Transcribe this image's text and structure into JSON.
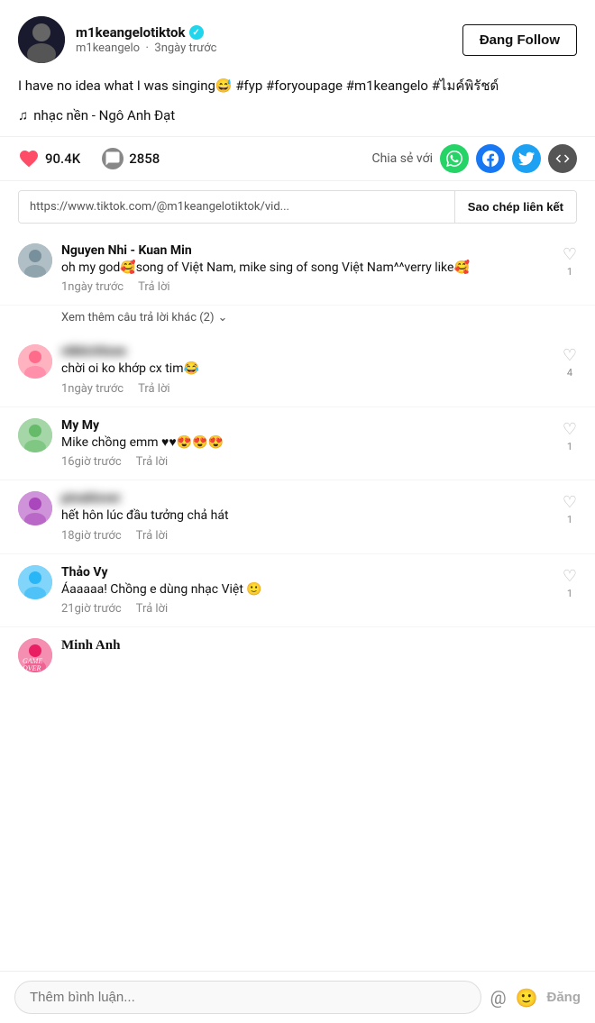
{
  "header": {
    "username": "m1keangelotiktok",
    "handle": "m1keangelo",
    "time_ago": "3ngày trước",
    "verified": true,
    "follow_label": "Đang Follow"
  },
  "caption": {
    "text": "I have no idea what I was singing😅 #fyp #foryoupage #m1keangelo #ไมค์พิรัชด์"
  },
  "music": {
    "note": "♫",
    "label": "nhạc nền - Ngô Anh Đạt"
  },
  "stats": {
    "likes": "90.4K",
    "comments": "2858",
    "share_label": "Chia sẻ với"
  },
  "url": {
    "value": "https://www.tiktok.com/@m1keangelotiktok/vid...",
    "copy_label": "Sao chép liên kết"
  },
  "comments": [
    {
      "id": 1,
      "username": "Nguyen Nhi - Kuan Min",
      "text": "oh my god🥰song of Việt Nam, mike sing of song Việt Nam^^verry like🥰",
      "time": "1ngày trước",
      "reply": "Trả lời",
      "likes": 1,
      "has_more_replies": true,
      "more_replies_label": "Xem thêm câu trả lời khác (2)",
      "avatar_class": "av1"
    },
    {
      "id": 2,
      "username": "blurred_user_2",
      "username_blurred": true,
      "text": "chời oi ko khớp cx tim😂",
      "time": "1ngày trước",
      "reply": "Trả lời",
      "likes": 4,
      "avatar_class": "av2"
    },
    {
      "id": 3,
      "username": "My My",
      "text": "Mike chồng emm ♥♥😍😍😍",
      "time": "16giờ trước",
      "reply": "Trả lời",
      "likes": 1,
      "avatar_class": "av3"
    },
    {
      "id": 4,
      "username": "blurred_user_4",
      "username_blurred": true,
      "text": "hết hôn lúc đầu tưởng chả hát",
      "time": "18giờ trước",
      "reply": "Trả lời",
      "likes": 1,
      "avatar_class": "av4"
    },
    {
      "id": 5,
      "username": "Thảo Vy",
      "text": "Áaaaaa! Chồng e dùng nhạc Việt 🙂",
      "time": "21giờ trước",
      "reply": "Trả lời",
      "likes": 1,
      "avatar_class": "av5"
    },
    {
      "id": 6,
      "username": "Minh Anh",
      "text": "",
      "time": "",
      "reply": "",
      "likes": 0,
      "avatar_class": "av6"
    }
  ],
  "comment_input": {
    "placeholder": "Thêm bình luận...",
    "post_label": "Đăng"
  }
}
